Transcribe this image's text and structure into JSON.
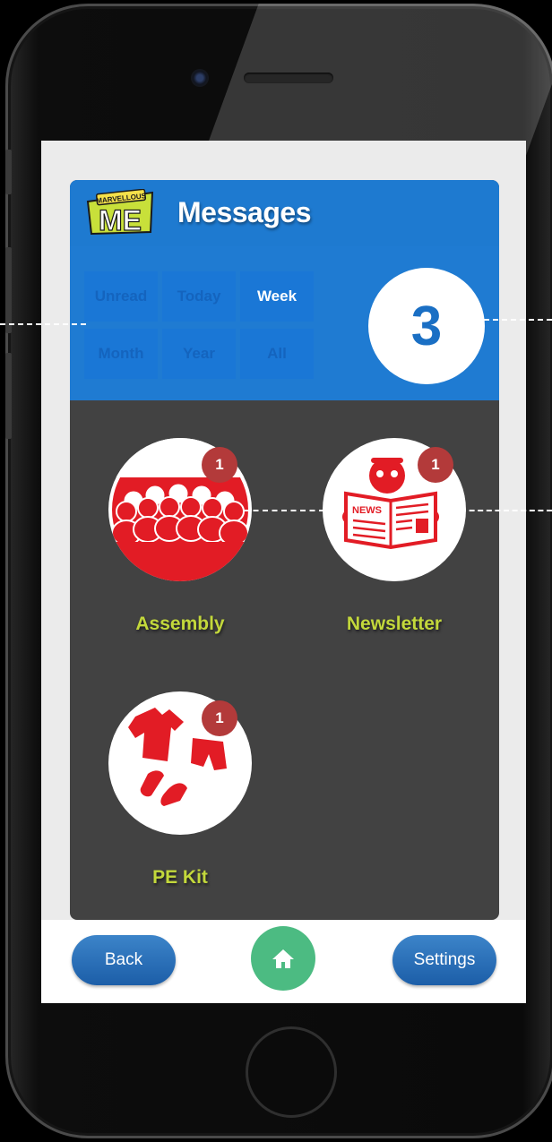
{
  "header": {
    "logo_text": "MARVELLOUS ME",
    "title": "Messages"
  },
  "filters": {
    "items": [
      {
        "label": "Unread",
        "active": false
      },
      {
        "label": "Today",
        "active": false
      },
      {
        "label": "Week",
        "active": true
      },
      {
        "label": "Month",
        "active": false
      },
      {
        "label": "Year",
        "active": false
      },
      {
        "label": "All",
        "active": false
      }
    ]
  },
  "count": "3",
  "categories": [
    {
      "label": "Assembly",
      "badge": "1",
      "icon": "assembly-icon"
    },
    {
      "label": "Newsletter",
      "badge": "1",
      "icon": "newsletter-icon"
    },
    {
      "label": "PE Kit",
      "badge": "1",
      "icon": "pe-kit-icon"
    }
  ],
  "newsletter_icon_text": "NEWS",
  "bottom": {
    "back_label": "Back",
    "settings_label": "Settings",
    "home_icon": "home-icon"
  },
  "colors": {
    "header_blue": "#1e7ad0",
    "panel_dark": "#424242",
    "label_green": "#c3d83b",
    "icon_red": "#e21c25",
    "badge_red": "#b33a3a",
    "home_green": "#4cbb82"
  }
}
